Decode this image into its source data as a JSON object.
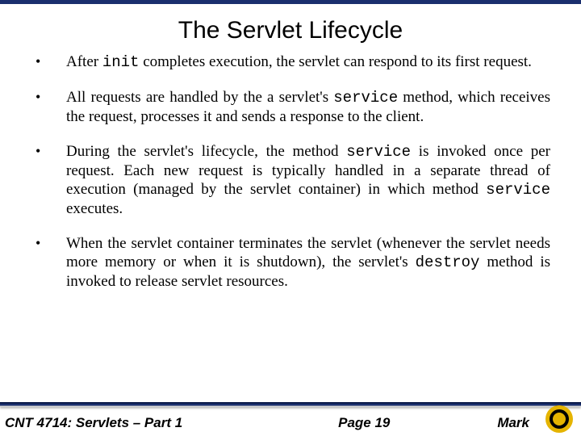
{
  "title": "The Servlet Lifecycle",
  "bullets": [
    {
      "parts": [
        {
          "t": "After ",
          "code": false
        },
        {
          "t": "init",
          "code": true
        },
        {
          "t": "  completes execution, the servlet can respond to its first request.",
          "code": false
        }
      ]
    },
    {
      "parts": [
        {
          "t": "All requests are handled by the a servlet's ",
          "code": false
        },
        {
          "t": "service",
          "code": true
        },
        {
          "t": "  method, which receives the request, processes it and sends a response to the client.",
          "code": false
        }
      ]
    },
    {
      "parts": [
        {
          "t": "During the servlet's lifecycle, the method ",
          "code": false
        },
        {
          "t": "service",
          "code": true
        },
        {
          "t": " is invoked once per request.  Each new request is typically handled in a separate thread of execution (managed by the servlet container) in which method ",
          "code": false
        },
        {
          "t": "service",
          "code": true
        },
        {
          "t": "  executes.",
          "code": false
        }
      ]
    },
    {
      "parts": [
        {
          "t": "When the servlet container terminates the servlet (whenever the servlet needs more memory or when it is shutdown), the servlet's ",
          "code": false
        },
        {
          "t": "destroy",
          "code": true
        },
        {
          "t": " method is invoked to release servlet resources.",
          "code": false
        }
      ]
    }
  ],
  "footer": {
    "left": "CNT 4714: Servlets – Part 1",
    "center": "Page 19",
    "right": "Mark"
  },
  "bullet_char": "•"
}
